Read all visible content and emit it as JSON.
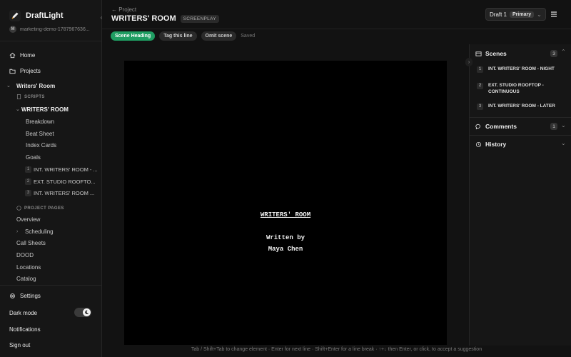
{
  "app": {
    "name": "DraftLight",
    "workspace_initial": "M",
    "workspace_name": "marketing-demo-1787967636..."
  },
  "sidebar": {
    "home": "Home",
    "projects": "Projects",
    "project_name": "Writers' Room",
    "scripts_label": "SCRIPTS",
    "script_title": "WRITERS' ROOM",
    "script_items": [
      "Breakdown",
      "Beat Sheet",
      "Index Cards",
      "Goals"
    ],
    "scenes": [
      {
        "num": "1",
        "label": "INT. WRITERS' ROOM - ..."
      },
      {
        "num": "2",
        "label": "EXT. STUDIO ROOFTO..."
      },
      {
        "num": "3",
        "label": "INT. WRITERS' ROOM ..."
      }
    ],
    "project_pages_label": "PROJECT PAGES",
    "pages": [
      "Overview",
      "Scheduling",
      "Call Sheets",
      "DOOD",
      "Locations",
      "Catalog"
    ],
    "settings": "Settings",
    "dark_mode": "Dark mode",
    "notifications": "Notifications",
    "sign_out": "Sign out"
  },
  "header": {
    "breadcrumb": "← Project",
    "title": "WRITERS' ROOM",
    "badge": "SCREENPLAY",
    "draft": "Draft 1",
    "draft_status": "Primary"
  },
  "toolbar": {
    "element": "Scene Heading",
    "tag": "Tag this line",
    "omit": "Omit scene",
    "saved": "Saved"
  },
  "title_page": {
    "title": "WRITERS' ROOM",
    "written_by": "Written by",
    "author": "Maya Chen"
  },
  "status_hint": "Tab / Shift+Tab to change element · Enter for next line · Shift+Enter for a line break · ↑+↓ then Enter, or click, to accept a suggestion",
  "right_panel": {
    "scenes_label": "Scenes",
    "scenes_count": "3",
    "scenes": [
      {
        "num": "1",
        "label": "INT. WRITERS' ROOM - NIGHT"
      },
      {
        "num": "2",
        "label": "EXT. STUDIO ROOFTOP - CONTINUOUS"
      },
      {
        "num": "3",
        "label": "INT. WRITERS' ROOM - LATER"
      }
    ],
    "comments_label": "Comments",
    "comments_count": "1",
    "history_label": "History"
  },
  "colors": {
    "accent": "#1f9d62",
    "background": "#121212",
    "page": "#000000"
  }
}
